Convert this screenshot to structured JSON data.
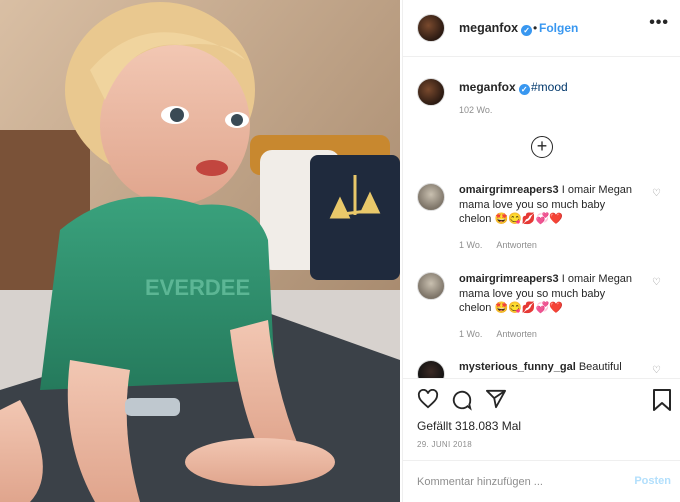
{
  "header": {
    "username": "meganfox",
    "dot": "•",
    "follow_label": "Folgen",
    "more_label": "•••"
  },
  "caption": {
    "username": "meganfox",
    "text": "#mood",
    "time": "102 Wo."
  },
  "load_more_label": "+",
  "comments": [
    {
      "username": "omairgrimreapers3",
      "text": "I omair Megan mama love you so much baby chelon 🤩😋💋💞❤️",
      "time": "1 Wo.",
      "reply_label": "Antworten"
    },
    {
      "username": "omairgrimreapers3",
      "text": "I omair Megan mama love you so much baby chelon 🤩😋💋💞❤️",
      "time": "1 Wo.",
      "reply_label": "Antworten"
    },
    {
      "username": "mysterious_funny_gal",
      "text": "Beautiful"
    }
  ],
  "actions": {
    "likes_text": "Gefällt 318.083 Mal",
    "date": "29. JUNI 2018"
  },
  "add_comment": {
    "placeholder": "Kommentar hinzufügen ...",
    "post_label": "Posten"
  },
  "colors": {
    "accent": "#3897f0",
    "text": "#262626",
    "muted": "#8e8e8e",
    "post_disabled": "#b2dffc"
  }
}
